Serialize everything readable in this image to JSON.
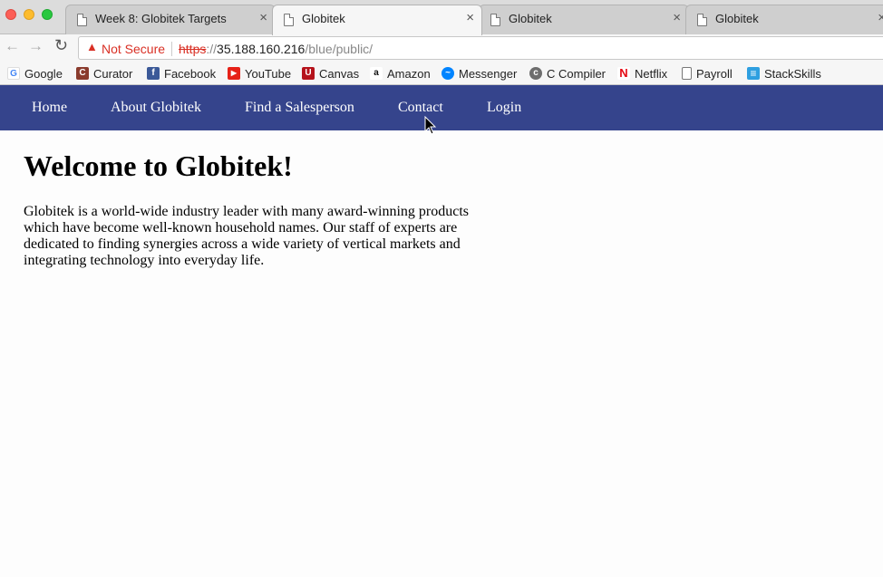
{
  "browser": {
    "tabs": [
      {
        "title": "Week 8: Globitek Targets",
        "close": "×",
        "active": false
      },
      {
        "title": "Globitek",
        "close": "×",
        "active": true
      },
      {
        "title": "Globitek",
        "close": "×",
        "active": false
      },
      {
        "title": "Globitek",
        "close": "×",
        "active": false
      }
    ],
    "address": {
      "security_label": "Not Secure",
      "scheme": "https",
      "separator": "://",
      "host": "35.188.160.216",
      "path": "/blue/public/"
    },
    "bookmarks": [
      {
        "label": "Google",
        "icon": "google-icon",
        "color": "#4285f4"
      },
      {
        "label": "Curator",
        "icon": "curator-icon",
        "color": "#8a3b2d"
      },
      {
        "label": "Facebook",
        "icon": "facebook-icon",
        "color": "#3b5998"
      },
      {
        "label": "YouTube",
        "icon": "youtube-icon",
        "color": "#e62117"
      },
      {
        "label": "Canvas",
        "icon": "canvas-icon",
        "color": "#b5121b"
      },
      {
        "label": "Amazon",
        "icon": "amazon-icon",
        "color": "#111111"
      },
      {
        "label": "Messenger",
        "icon": "messenger-icon",
        "color": "#0084ff"
      },
      {
        "label": "C Compiler",
        "icon": "c-compiler-icon",
        "color": "#6d6d6d"
      },
      {
        "label": "Netflix",
        "icon": "netflix-icon",
        "color": "#e50914"
      },
      {
        "label": "Payroll",
        "icon": "page-icon",
        "color": "#777777"
      },
      {
        "label": "StackSkills",
        "icon": "stackskills-icon",
        "color": "#2e9fe0"
      }
    ]
  },
  "site": {
    "nav": [
      "Home",
      "About Globitek",
      "Find a Salesperson",
      "Contact",
      "Login"
    ],
    "heading": "Welcome to Globitek!",
    "intro": "Globitek is a world-wide industry leader with many award-winning products which have become well-known household names. Our staff of experts are dedicated to finding synergies across a wide variety of vertical markets and integrating technology into everyday life.",
    "nav_color": "#35448c"
  }
}
